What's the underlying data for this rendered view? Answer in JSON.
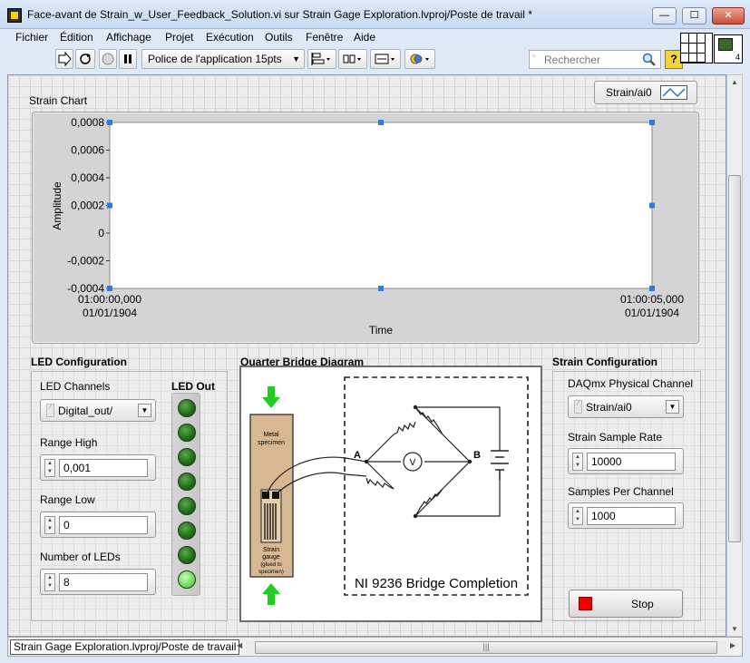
{
  "window": {
    "title": "Face-avant de Strain_w_User_Feedback_Solution.vi sur Strain Gage Exploration.lvproj/Poste de travail *",
    "min_glyph": "—",
    "max_glyph": "☐",
    "close_glyph": "✕"
  },
  "menu": [
    "Fichier",
    "Édition",
    "Affichage",
    "Projet",
    "Exécution",
    "Outils",
    "Fenêtre",
    "Aide"
  ],
  "toolbar": {
    "font_select": "Police de l'application 15pts",
    "search_placeholder": "Rechercher",
    "help_glyph": "?"
  },
  "chart": {
    "section_label": "Strain Chart",
    "legend_name": "Strain/ai0"
  },
  "chart_data": {
    "type": "line",
    "title": "Strain Chart",
    "xlabel": "Time",
    "ylabel": "Amplitude",
    "y_ticks": [
      "0,0008",
      "0,0006",
      "0,0004",
      "0,0002",
      "0",
      "-0,0002",
      "-0,0004"
    ],
    "x_tick_labels": [
      {
        "time": "01:00:00,000",
        "date": "01/01/1904"
      },
      {
        "time": "01:00:05,000",
        "date": "01/01/1904"
      }
    ],
    "ylim": [
      -0.0004,
      0.0008
    ],
    "series": [
      {
        "name": "Strain/ai0",
        "values": []
      }
    ],
    "grid": false,
    "legend": "top-right"
  },
  "led_config": {
    "section_label": "LED Configuration",
    "channels_label": "LED Channels",
    "channels_value": "Digital_out/",
    "range_high_label": "Range High",
    "range_high_value": "0,001",
    "range_low_label": "Range Low",
    "range_low_value": "0",
    "num_leds_label": "Number of LEDs",
    "num_leds_value": "8",
    "led_out_label": "LED Out",
    "led_states": [
      false,
      false,
      false,
      false,
      false,
      false,
      false,
      true
    ]
  },
  "diagram": {
    "section_label": "Quarter Bridge Diagram",
    "specimen_label_1": "Metal",
    "specimen_label_2": "specimen",
    "gauge_label_1": "Strain",
    "gauge_label_2": "gauge",
    "gauge_label_3": "(glued to",
    "gauge_label_4": "specimen)",
    "node_a": "A",
    "node_b": "B",
    "meter": "V",
    "caption": "NI 9236 Bridge Completion"
  },
  "strain_config": {
    "section_label": "Strain Configuration",
    "channel_label": "DAQmx Physical Channel",
    "channel_value": "Strain/ai0",
    "sample_rate_label": "Strain Sample Rate",
    "sample_rate_value": "10000",
    "samples_per_channel_label": "Samples Per Channel",
    "samples_per_channel_value": "1000",
    "stop_label": "Stop"
  },
  "status": {
    "text": "Strain Gage Exploration.lvproj/Poste de travail",
    "scroll_grip": "|||"
  },
  "colors": {
    "stop_red": "#ee0000",
    "led_on": "#6fdd56",
    "led_off": "#1f6a17",
    "arrow_green": "#22cc22",
    "specimen_tan": "#d8b892"
  }
}
